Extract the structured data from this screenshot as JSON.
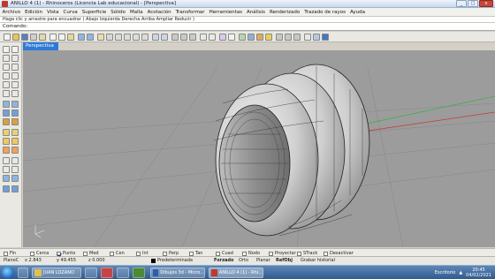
{
  "window": {
    "title": "ANILLO 4 (1) - Rhinoceros (Licencia Lab educacional) - [Perspectiva]",
    "btn_min": "_",
    "btn_max": "□",
    "btn_close": "x"
  },
  "menu": [
    "Archivo",
    "Edición",
    "Vista",
    "Curva",
    "Superficie",
    "Sólido",
    "Malla",
    "Acotación",
    "Transformar",
    "Herramientas",
    "Análisis",
    "Renderizado",
    "Trazado de rayos",
    "Ayuda"
  ],
  "command": {
    "history": "Haga clic y arrastre para encuadrar ( Abajo Izquierda Derecha Arriba Ampliar Reducir )",
    "prompt": "Comando:"
  },
  "viewport": {
    "tab": "Perspectiva",
    "background": "#9c9c9c"
  },
  "osnaps": [
    {
      "label": "Fin",
      "checked": false
    },
    {
      "label": "Cerca",
      "checked": false
    },
    {
      "label": "Punto",
      "checked": true
    },
    {
      "label": "Med",
      "checked": false
    },
    {
      "label": "Cen",
      "checked": false
    },
    {
      "label": "Int",
      "checked": false
    },
    {
      "label": "Perp",
      "checked": false
    },
    {
      "label": "Tan",
      "checked": false
    },
    {
      "label": "Cuad",
      "checked": false
    },
    {
      "label": "Nodo",
      "checked": false
    },
    {
      "label": "Proyectar",
      "checked": false
    },
    {
      "label": "STrack",
      "checked": false
    },
    {
      "label": "Desactivar",
      "checked": false
    }
  ],
  "status": {
    "plane": "PlanoC",
    "x": "x 2.843",
    "y": "y 49.455",
    "z": "z 0.000",
    "layer": "Predeterminada",
    "forzado": "Forzado",
    "orto": "Orto",
    "planar": "Planar",
    "refobj": "RefObj",
    "history": "Grabar historial"
  },
  "taskbar": {
    "item_user": "JUAN LOZANO",
    "item_word": "Dibujos 3d - Micro...",
    "item_rhino": "ANILLO 4 (1) - Rhi...",
    "desktop": "Escritorio",
    "time": "20:45",
    "date": "04/02/2021"
  },
  "colors": {
    "accent": "#2f7ad8",
    "x_axis": "#c63b3b",
    "y_axis": "#3bb14a"
  }
}
